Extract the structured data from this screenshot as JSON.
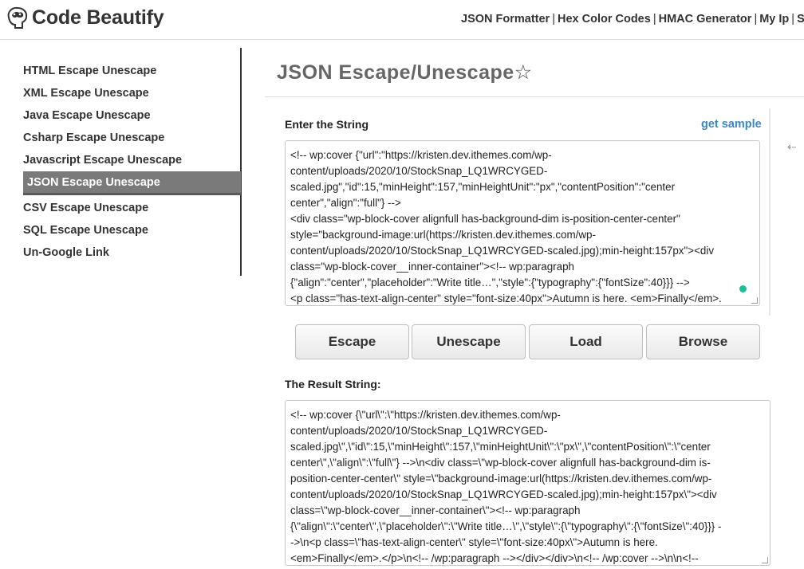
{
  "header": {
    "logo_text": "Code Beautify",
    "nav": [
      "JSON Formatter",
      "Hex Color Codes",
      "HMAC Generator",
      "My Ip",
      "S"
    ]
  },
  "sidebar": {
    "items": [
      {
        "label": "HTML Escape Unescape",
        "active": false
      },
      {
        "label": "XML Escape Unescape",
        "active": false
      },
      {
        "label": "Java Escape Unescape",
        "active": false
      },
      {
        "label": "Csharp Escape Unescape",
        "active": false
      },
      {
        "label": "Javascript Escape Unescape",
        "active": false
      },
      {
        "label": "JSON Escape Unescape",
        "active": true
      },
      {
        "label": "CSV Escape Unescape",
        "active": false
      },
      {
        "label": "SQL Escape Unescape",
        "active": false
      },
      {
        "label": "Un-Google Link",
        "active": false
      }
    ]
  },
  "main": {
    "title": "JSON Escape/Unescape",
    "star": "☆",
    "input_label": "Enter the String",
    "get_sample": "get sample",
    "input_lines": [
      "<!-- wp:cover {\"url\":\"https://kristen.dev.ithemes.com/wp-",
      "content/uploads/2020/10/StockSnap_LQ1WRCYGED-",
      "scaled.jpg\",\"id\":15,\"minHeight\":157,\"minHeightUnit\":\"px\",\"contentPosition\":\"center",
      "center\",\"align\":\"full\"} -->",
      "<div class=\"wp-block-cover alignfull has-background-dim is-position-center-center\"",
      "style=\"background-image:url(https://kristen.dev.ithemes.com/wp-",
      "content/uploads/2020/10/StockSnap_LQ1WRCYGED-scaled.jpg);min-height:157px\"><div",
      "class=\"wp-block-cover__inner-container\"><!-- wp:paragraph",
      "{\"align\":\"center\",\"placeholder\":\"Write title…\",\"style\":{\"typography\":{\"fontSize\":40}}} -->",
      "<p class=\"has-text-align-center\" style=\"font-size:40px\">Autumn is here. <em>Finally</em>."
    ],
    "buttons": [
      "Escape",
      "Unescape",
      "Load",
      "Browse"
    ],
    "result_label": "The Result String:",
    "result_lines": [
      "<!-- wp:cover {\\\"url\\\":\\\"https://kristen.dev.ithemes.com/wp-",
      "content/uploads/2020/10/StockSnap_LQ1WRCYGED-",
      "scaled.jpg\\\",\\\"id\\\":15,\\\"minHeight\\\":157,\\\"minHeightUnit\\\":\\\"px\\\",\\\"contentPosition\\\":\\\"center",
      "center\\\",\\\"align\\\":\\\"full\\\"} -->\\n<div class=\\\"wp-block-cover alignfull has-background-dim is-",
      "position-center-center\\\" style=\\\"background-image:url(https://kristen.dev.ithemes.com/wp-",
      "content/uploads/2020/10/StockSnap_LQ1WRCYGED-scaled.jpg);min-height:157px\\\"><div",
      "class=\\\"wp-block-cover__inner-container\\\"><!-- wp:paragraph",
      "{\\\"align\\\":\\\"center\\\",\\\"placeholder\\\":\\\"Write title…\\\",\\\"style\\\":{\\\"typography\\\":{\\\"fontSize\\\":40}}} -",
      "->\\n<p class=\\\"has-text-align-center\\\" style=\\\"font-size:40px\\\">Autumn is here.",
      "<em>Finally</em>.</p>\\n<!-- /wp:paragraph --></div></div>\\n<!-- /wp:cover -->\\n\\n<!--"
    ]
  },
  "colors": {
    "active_sidebar_bg": "#7a7a7a",
    "link_blue": "#3b88c9",
    "title_gray": "#666666"
  },
  "icons": [
    "brain-logo-icon",
    "star-icon",
    "collapse-arrow-icon"
  ]
}
